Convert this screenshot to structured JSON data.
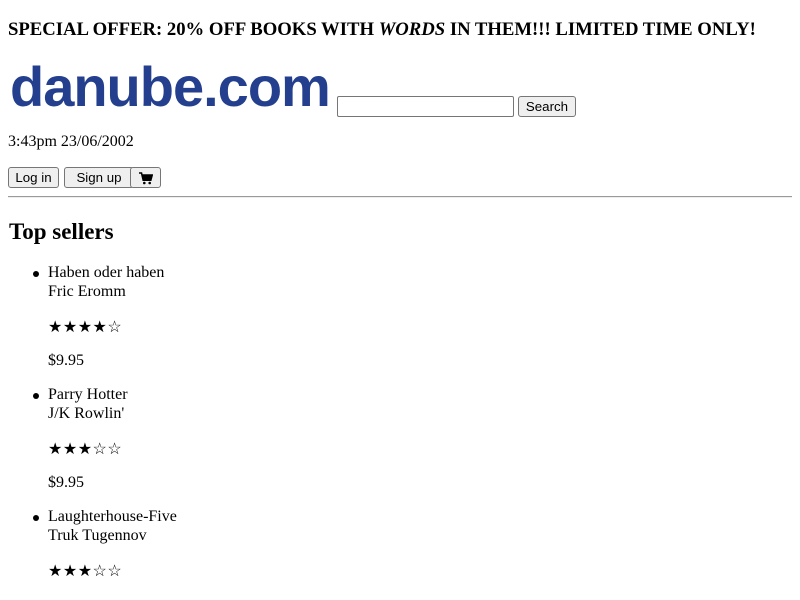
{
  "promo": {
    "prefix": "SPECIAL OFFER: 20% OFF BOOKS WITH ",
    "emphasis": "WORDS",
    "suffix": " IN THEM!!! LIMITED TIME ONLY!"
  },
  "header": {
    "logo_text": "danube.com",
    "logo_color": "#233f8d",
    "search": {
      "value": "",
      "placeholder": "",
      "button_label": "Search"
    }
  },
  "timestamp": "3:43pm 23/06/2002",
  "auth": {
    "login_label": "Log in",
    "signup_label": "Sign up",
    "cart_icon": "cart-icon"
  },
  "section": {
    "title": "Top sellers"
  },
  "books": [
    {
      "title": "Haben oder haben",
      "author": "Fric Eromm",
      "rating_text": "★★★★☆",
      "rating": 4,
      "rating_max": 5,
      "price": "$9.95"
    },
    {
      "title": "Parry Hotter",
      "author": "J/K Rowlin'",
      "rating_text": "★★★☆☆",
      "rating": 3,
      "rating_max": 5,
      "price": "$9.95"
    },
    {
      "title": "Laughterhouse-Five",
      "author": "Truk Tugennov",
      "rating_text": "★★★☆☆",
      "rating": 3,
      "rating_max": 5,
      "price": ""
    }
  ]
}
